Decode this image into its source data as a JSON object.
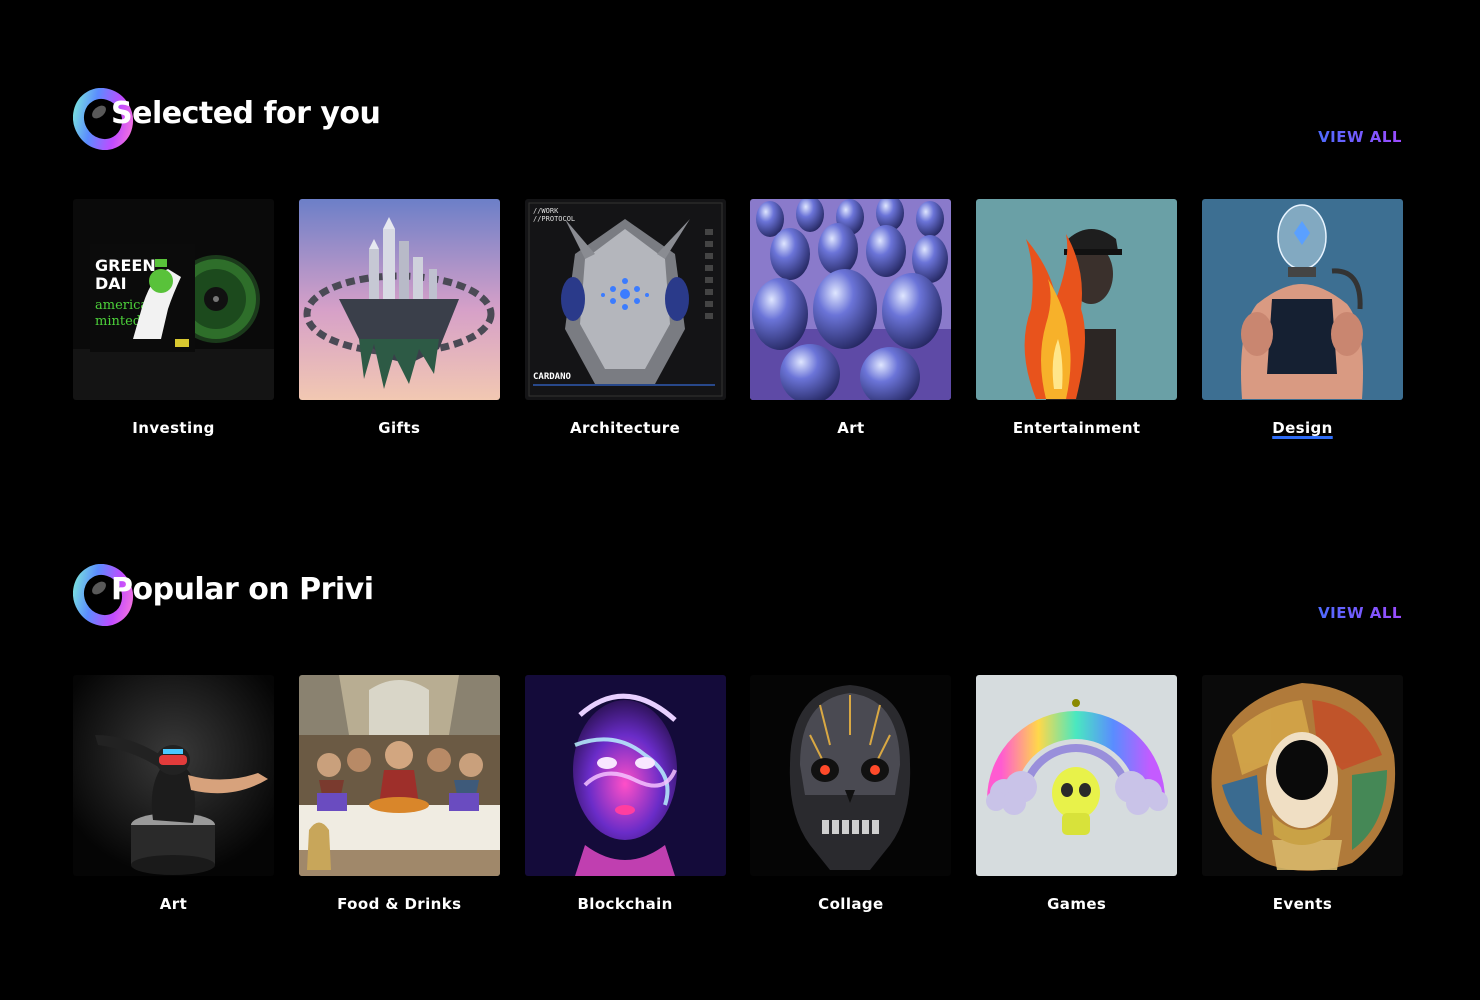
{
  "selected": {
    "title": "Selected for you",
    "view_all": "VIEW ALL",
    "items": [
      {
        "label": "Investing",
        "icon": "album-vinyl-image",
        "art_text": [
          "GREEN",
          "DAI",
          "american",
          "minted"
        ]
      },
      {
        "label": "Gifts",
        "icon": "floating-castle-image"
      },
      {
        "label": "Architecture",
        "icon": "cyber-helmet-image",
        "art_text": [
          "//WORK",
          "//PROTOCOL",
          "CARDANO"
        ]
      },
      {
        "label": "Art",
        "icon": "chrome-heads-image"
      },
      {
        "label": "Entertainment",
        "icon": "burning-figure-image"
      },
      {
        "label": "Design",
        "icon": "glass-head-bodybuilder-image"
      }
    ]
  },
  "popular": {
    "title": "Popular on Privi",
    "view_all": "VIEW ALL",
    "items": [
      {
        "label": "Art",
        "icon": "dancing-astronaut-image"
      },
      {
        "label": "Food & Drinks",
        "icon": "last-supper-image"
      },
      {
        "label": "Blockchain",
        "icon": "neon-portrait-image"
      },
      {
        "label": "Collage",
        "icon": "cyber-skull-image"
      },
      {
        "label": "Games",
        "icon": "rainbow-skull-image"
      },
      {
        "label": "Events",
        "icon": "mosaic-collage-image"
      }
    ]
  },
  "colors": {
    "background": "#000000",
    "accent_start": "#4e6bff",
    "accent_end": "#9d4bff",
    "underline": "#2f6df6"
  }
}
